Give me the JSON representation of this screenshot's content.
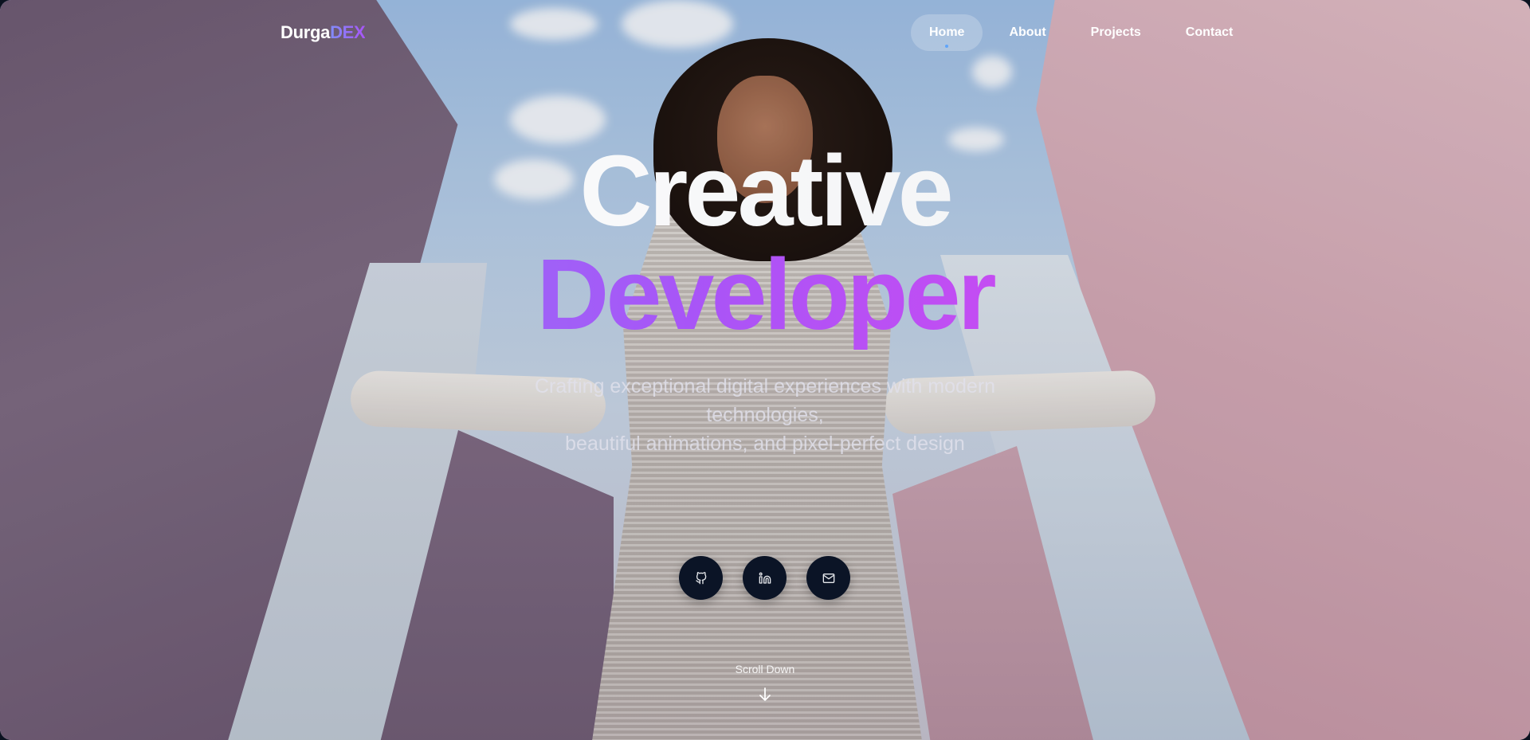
{
  "brand": {
    "name_part1": "Durga",
    "name_part2": "DEX"
  },
  "nav": {
    "items": [
      {
        "label": "Home",
        "active": true
      },
      {
        "label": "About",
        "active": false
      },
      {
        "label": "Projects",
        "active": false
      },
      {
        "label": "Contact",
        "active": false
      }
    ]
  },
  "hero": {
    "title_line1": "Creative",
    "title_line2": "Developer",
    "subtitle_line1": "Crafting exceptional digital experiences with modern",
    "subtitle_line2": "technologies,",
    "subtitle_line3": "beautiful animations, and pixel-perfect design"
  },
  "socials": [
    {
      "icon": "github-icon"
    },
    {
      "icon": "linkedin-icon"
    },
    {
      "icon": "mail-icon"
    }
  ],
  "scroll": {
    "label": "Scroll Down",
    "icon": "arrow-down-icon"
  },
  "colors": {
    "accent_start": "#818cf8",
    "accent_mid": "#a855f7",
    "accent_end": "#ec4899",
    "social_bg": "#0b1426",
    "active_dot": "#60a5fa"
  }
}
